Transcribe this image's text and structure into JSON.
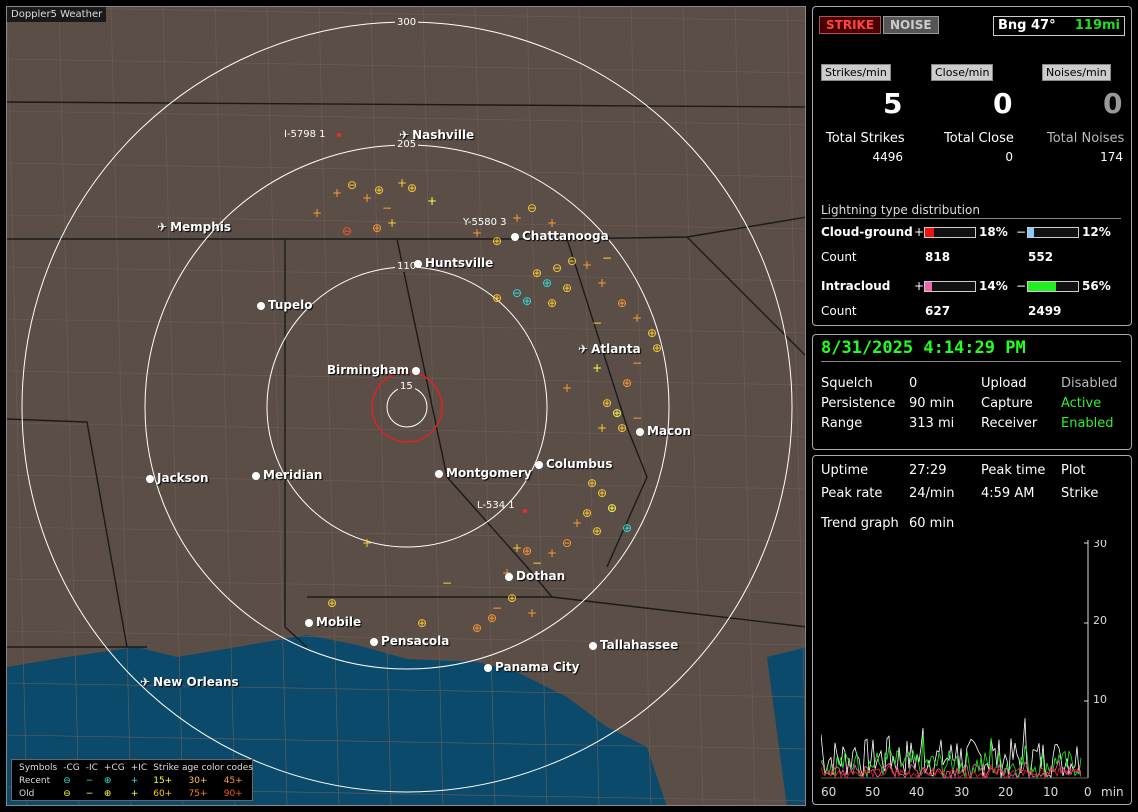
{
  "app": {
    "title": "Doppler5 Weather"
  },
  "map": {
    "range_labels": [
      "300",
      "205",
      "110",
      "15"
    ],
    "cities": [
      {
        "name": "Nashville",
        "type": "airport"
      },
      {
        "name": "Memphis",
        "type": "airport"
      },
      {
        "name": "Chattanooga",
        "type": "city"
      },
      {
        "name": "Huntsville",
        "type": "city"
      },
      {
        "name": "Tupelo",
        "type": "city"
      },
      {
        "name": "Atlanta",
        "type": "airport"
      },
      {
        "name": "Birmingham",
        "type": "city"
      },
      {
        "name": "Macon",
        "type": "city"
      },
      {
        "name": "Columbus",
        "type": "city"
      },
      {
        "name": "Jackson",
        "type": "city"
      },
      {
        "name": "Meridian",
        "type": "city"
      },
      {
        "name": "Montgomery",
        "type": "city"
      },
      {
        "name": "Dothan",
        "type": "city"
      },
      {
        "name": "Mobile",
        "type": "city"
      },
      {
        "name": "Pensacola",
        "type": "city"
      },
      {
        "name": "Tallahassee",
        "type": "city"
      },
      {
        "name": "Panama City",
        "type": "city"
      },
      {
        "name": "New Orleans",
        "type": "airport"
      }
    ],
    "markers": [
      "I-5798 1",
      "Y-5580 3",
      "L-534 1"
    ]
  },
  "legend": {
    "header": [
      "Symbols",
      "-CG",
      "-IC",
      "+CG",
      "+IC",
      "Strike age color codes"
    ],
    "recent_label": "Recent",
    "old_label": "Old",
    "recent_codes": [
      "15+",
      "30+",
      "45+"
    ],
    "old_codes": [
      "60+",
      "75+",
      "90+"
    ],
    "colors": {
      "c15": "#ffff44",
      "c30": "#ffcc33",
      "c45": "#ff9933",
      "c60": "#ffcc00",
      "c75": "#ff8800",
      "c90": "#ff5522"
    }
  },
  "top_panel": {
    "strike_btn": "STRIKE",
    "noise_btn": "NOISE",
    "bearing": "Bng 47°",
    "distance": "119mi",
    "strikes_min_label": "Strikes/min",
    "close_min_label": "Close/min",
    "noises_min_label": "Noises/min",
    "strikes_min": "5",
    "close_min": "0",
    "noises_min": "0",
    "total_strikes_label": "Total Strikes",
    "total_close_label": "Total Close",
    "total_noises_label": "Total Noises",
    "total_strikes": "4496",
    "total_close": "0",
    "total_noises": "174",
    "dist_title": "Lightning type distribution",
    "cg_label": "Cloud-ground",
    "ic_label": "Intracloud",
    "count_label": "Count",
    "plus": "+",
    "minus": "−",
    "cg_pos_pct": "18%",
    "cg_neg_pct": "12%",
    "ic_pos_pct": "14%",
    "ic_neg_pct": "56%",
    "cg_pos_count": "818",
    "cg_neg_count": "552",
    "ic_pos_count": "627",
    "ic_neg_count": "2499",
    "bars": {
      "cg_pos": 0.18,
      "cg_neg": 0.12,
      "ic_pos": 0.14,
      "ic_neg": 0.56
    },
    "bar_colors": {
      "cg_pos": "#ee1111",
      "cg_neg": "#88ccff",
      "ic_pos": "#ee66aa",
      "ic_neg": "#22ee22"
    }
  },
  "status_panel": {
    "datetime": "8/31/2025 4:14:29 PM",
    "squelch_label": "Squelch",
    "squelch": "0",
    "persistence_label": "Persistence",
    "persistence": "90 min",
    "range_label": "Range",
    "range": "313 mi",
    "upload_label": "Upload",
    "upload": "Disabled",
    "capture_label": "Capture",
    "capture": "Active",
    "receiver_label": "Receiver",
    "receiver": "Enabled"
  },
  "trend_panel": {
    "uptime_label": "Uptime",
    "uptime": "27:29",
    "peak_time_label": "Peak time",
    "peak_time": "4:59 AM",
    "plot_label": "Plot",
    "plot": "Strike",
    "peak_rate_label": "Peak rate",
    "peak_rate": "24/min",
    "trend_label": "Trend graph",
    "trend": "60 min",
    "y_ticks": [
      "30",
      "20",
      "10"
    ],
    "x_ticks": [
      "60",
      "50",
      "40",
      "30",
      "20",
      "10",
      "0"
    ],
    "x_unit": "min"
  }
}
